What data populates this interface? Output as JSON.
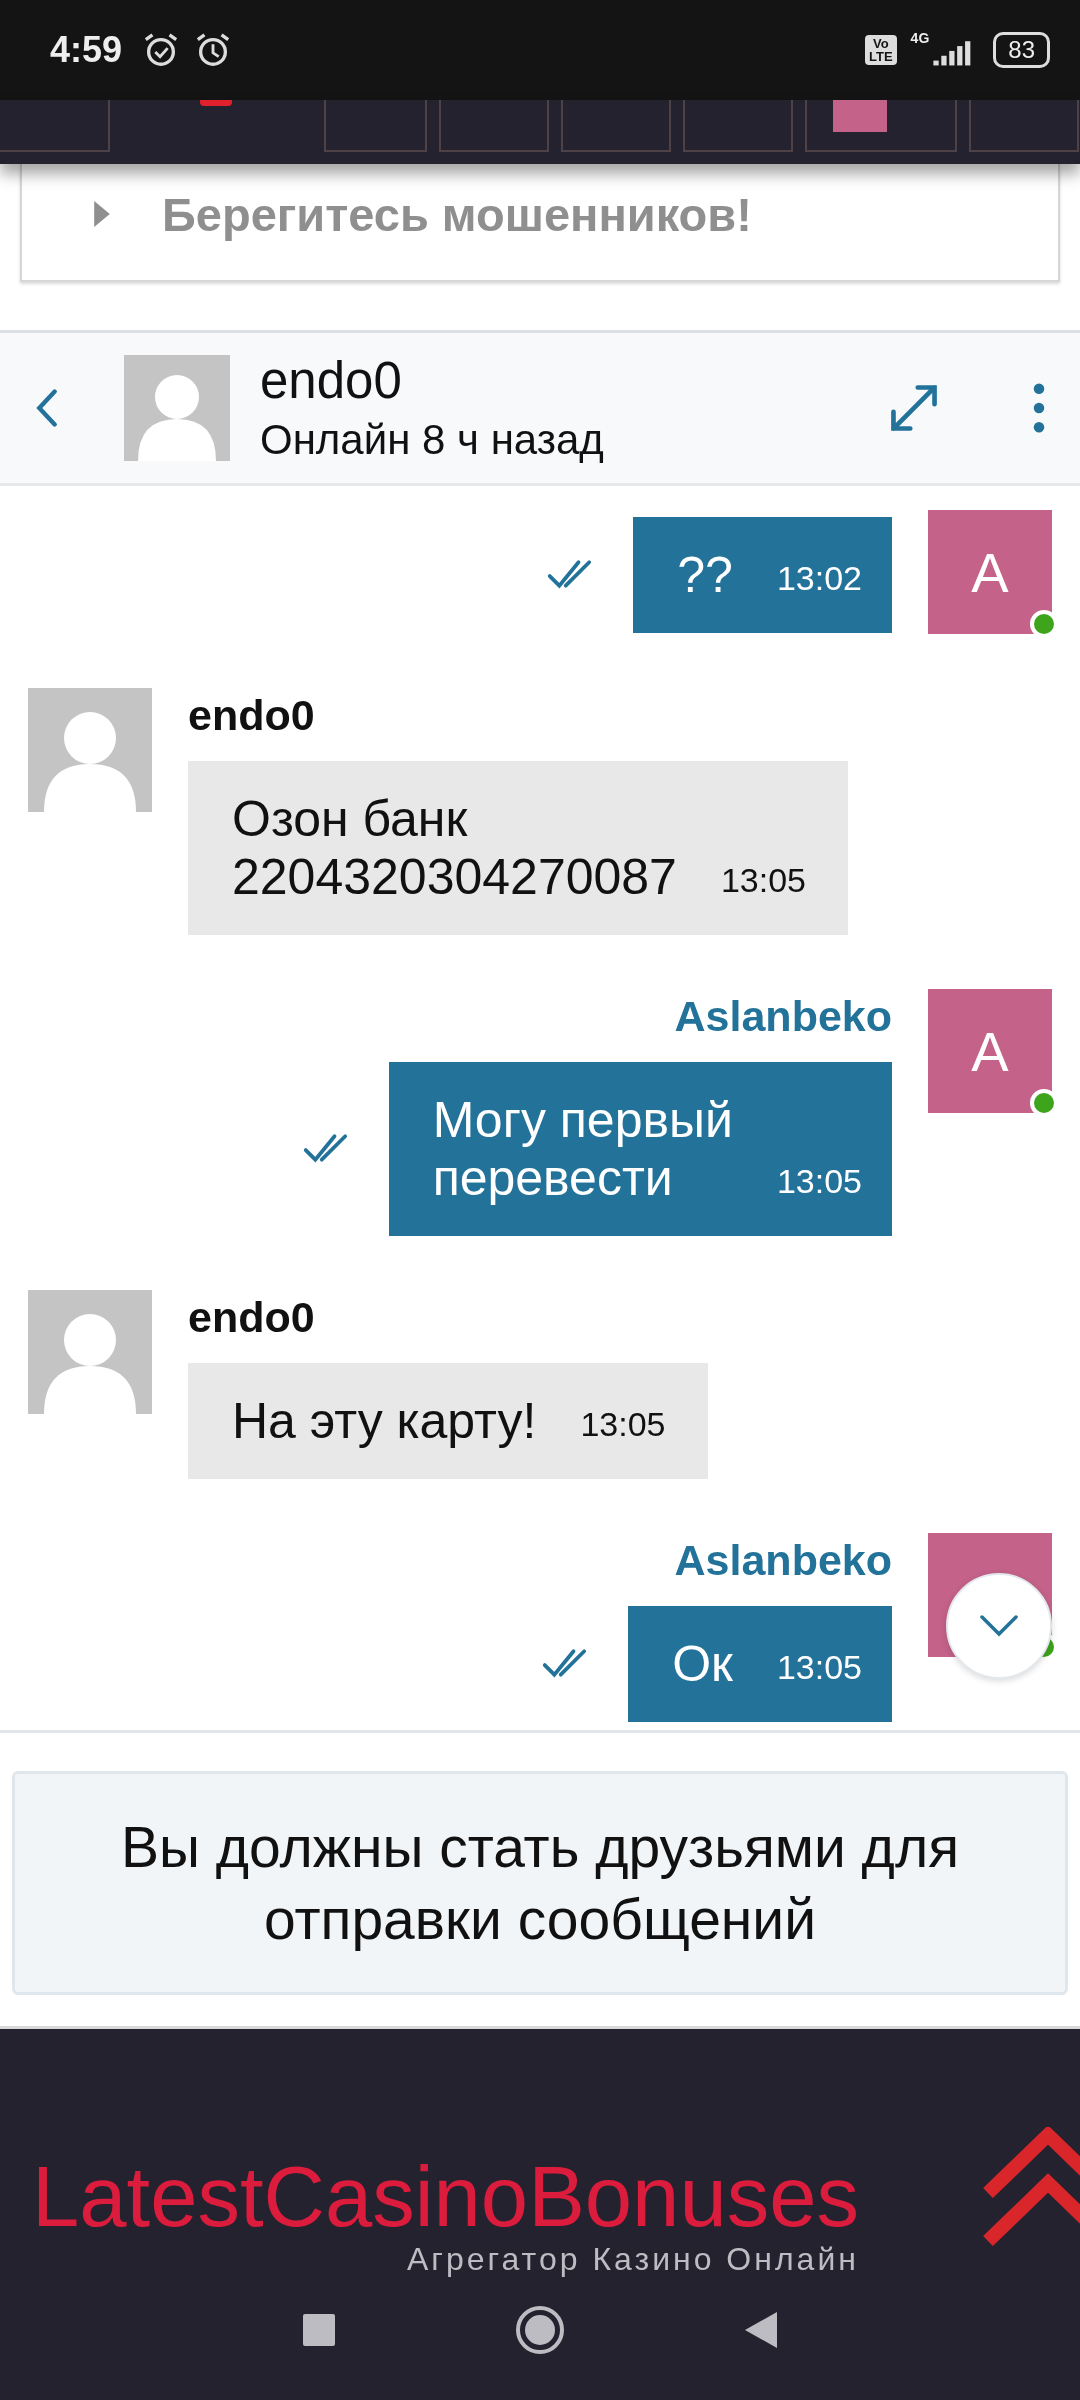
{
  "status_bar": {
    "time": "4:59",
    "volte": [
      "Vo",
      "LTE"
    ],
    "network": "4G",
    "battery": "83"
  },
  "warning": {
    "text": "Берегитесь мошенников!"
  },
  "chat_header": {
    "name": "endo0",
    "status": "Онлайн 8 ч назад"
  },
  "messages": [
    {
      "kind": "outgoing",
      "text": "??",
      "time": "13:02",
      "read": true,
      "avatar_letter": "A",
      "online": true
    },
    {
      "kind": "incoming",
      "author": "endo0",
      "text": "Озон банк\n2204320304270087",
      "time": "13:05"
    },
    {
      "kind": "outgoing",
      "author": "Aslanbeko",
      "text": "Могу первый\nперевести",
      "time": "13:05",
      "read": true,
      "avatar_letter": "A",
      "online": true
    },
    {
      "kind": "incoming",
      "author": "endo0",
      "text": "На эту карту!",
      "time": "13:05"
    },
    {
      "kind": "outgoing",
      "author": "Aslanbeko",
      "text": "Ок",
      "time": "13:05",
      "read": true,
      "online": true
    }
  ],
  "notice": {
    "text": "Вы должны стать друзьями для отправки сообщений"
  },
  "footer": {
    "logo": "LatestCasinoBonuses",
    "tagline": "Агрегатор Казино Онлайн"
  }
}
